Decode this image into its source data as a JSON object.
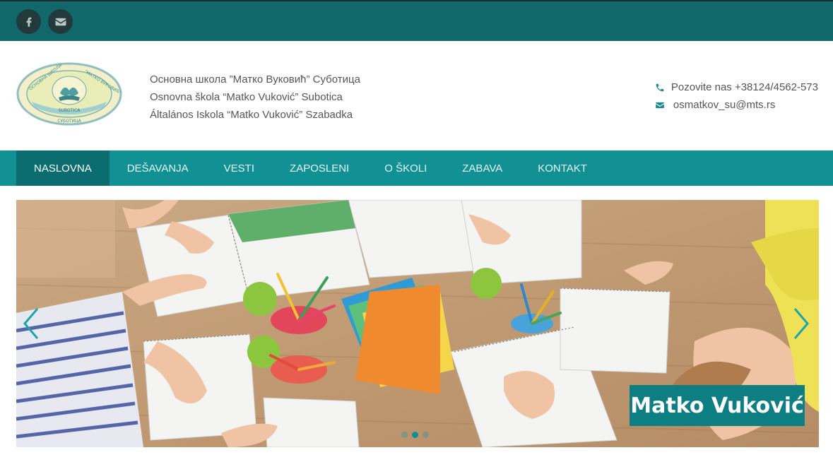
{
  "topbar": {
    "social": [
      {
        "icon": "facebook-icon"
      },
      {
        "icon": "envelope-icon"
      }
    ]
  },
  "header": {
    "school_names": [
      "Основна школа ”Матко Вуковић” Суботица",
      "Osnovna škola “Matko Vuković” Subotica",
      "Általános Iskola “Matko Vuković” Szabadka"
    ],
    "phone": "Pozovite nas +38124/4562-573",
    "email": "osmatkov_su@mts.rs",
    "logo_text": {
      "top_left": "ОСНОВНА ШКОЛА",
      "top_right": "”МАТКО ВУКОВИЋ”",
      "band": "SUBOTICA",
      "bottom": "СУБОТИЦА"
    }
  },
  "nav": {
    "items": [
      "NASLOVNA",
      "DEŠAVANJA",
      "VESTI",
      "ZAPOSLENI",
      "O ŠKOLI",
      "ZABAVA",
      "KONTAKT"
    ],
    "active_index": 0
  },
  "slider": {
    "caption": "Matko Vuković",
    "slide_count": 3,
    "active_slide": 1
  },
  "colors": {
    "topbar": "#10686b",
    "nav": "#129195",
    "nav_active": "#0c6d70",
    "accent": "#0d7f82"
  }
}
